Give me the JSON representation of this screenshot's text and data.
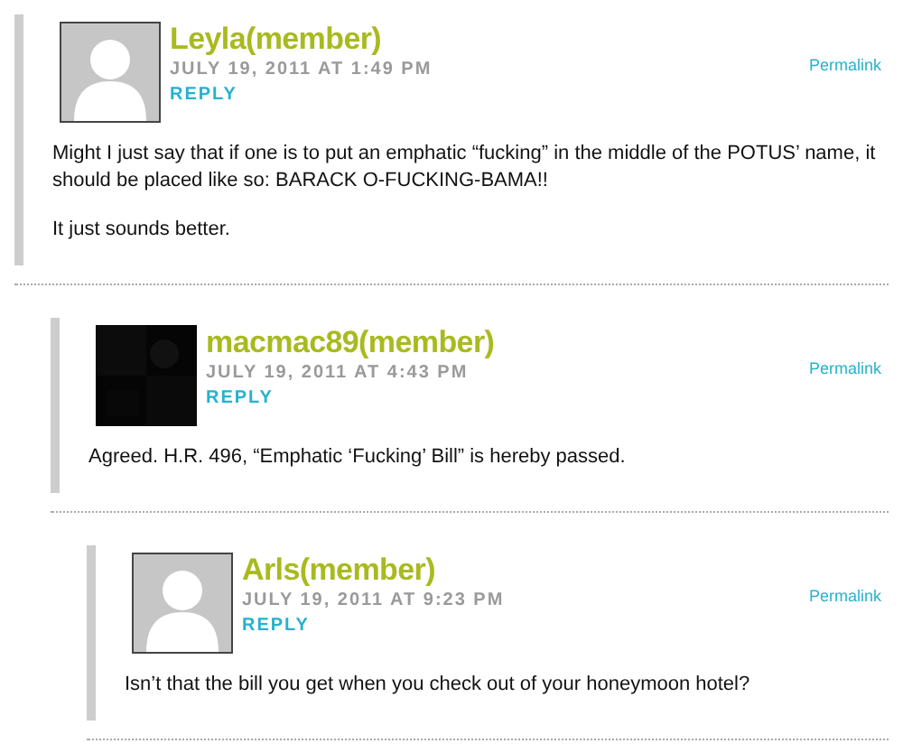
{
  "comments": [
    {
      "author": "Leyla(member)",
      "date": "JULY 19, 2011 AT 1:49 PM",
      "reply": "REPLY",
      "permalink": "Permalink",
      "avatar": {
        "kind": "placeholder"
      },
      "body": [
        "Might I just say that if one is to put an emphatic “fucking” in the middle of the POTUS’ name, it should be placed like so: BARACK O-FUCKING-BAMA!!",
        "It just sounds better."
      ],
      "children": [
        {
          "author": "macmac89(member)",
          "date": "JULY 19, 2011 AT 4:43 PM",
          "reply": "REPLY",
          "permalink": "Permalink",
          "avatar": {
            "kind": "picture"
          },
          "body": [
            "Agreed. H.R. 496, “Emphatic ‘Fucking’ Bill” is hereby passed."
          ],
          "children": [
            {
              "author": "Arls(member)",
              "date": "JULY 19, 2011 AT 9:23 PM",
              "reply": "REPLY",
              "permalink": "Permalink",
              "avatar": {
                "kind": "placeholder"
              },
              "body": [
                "Isn’t that the bill you get when you check out of your honeymoon hotel?"
              ]
            }
          ]
        }
      ]
    }
  ]
}
